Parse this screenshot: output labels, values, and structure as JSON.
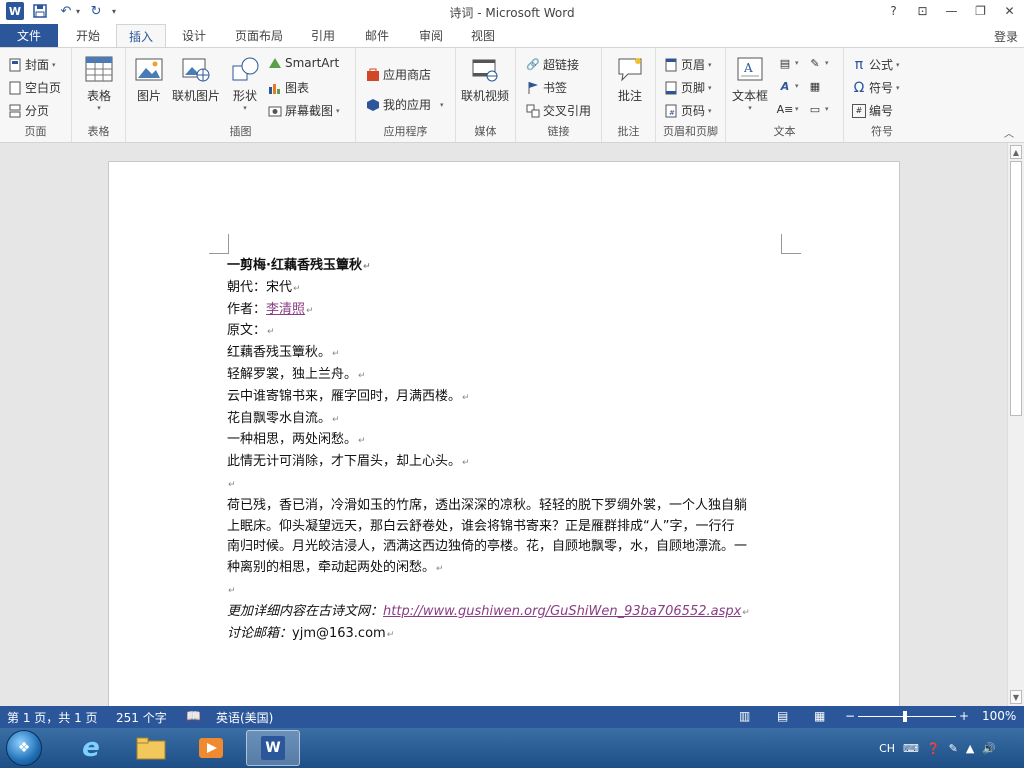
{
  "window": {
    "title": "诗词 - Microsoft Word",
    "controls": {
      "help": "?",
      "ribbon_opts": "⊡",
      "min": "—",
      "restore": "❐",
      "close": "✕"
    }
  },
  "qat": {
    "logo": "W"
  },
  "tabs": [
    {
      "label": "文件"
    },
    {
      "label": "开始"
    },
    {
      "label": "插入"
    },
    {
      "label": "设计"
    },
    {
      "label": "页面布局"
    },
    {
      "label": "引用"
    },
    {
      "label": "邮件"
    },
    {
      "label": "审阅"
    },
    {
      "label": "视图"
    }
  ],
  "login": "登录",
  "ribbon": {
    "groups": {
      "pages": {
        "label": "页面",
        "cover": "封面",
        "blank": "空白页",
        "break": "分页"
      },
      "tables": {
        "label": "表格",
        "table": "表格"
      },
      "illustrations": {
        "label": "插图",
        "picture": "图片",
        "online_picture": "联机图片",
        "shapes": "形状",
        "smartart": "SmartArt",
        "chart": "图表",
        "screenshot": "屏幕截图"
      },
      "apps": {
        "label": "应用程序",
        "store": "应用商店",
        "my_apps": "我的应用"
      },
      "media": {
        "label": "媒体",
        "online_video": "联机视频"
      },
      "links": {
        "label": "链接",
        "hyperlink": "超链接",
        "bookmark": "书签",
        "cross_ref": "交叉引用"
      },
      "comments": {
        "label": "批注",
        "comment": "批注"
      },
      "header_footer": {
        "label": "页眉和页脚",
        "header": "页眉",
        "footer": "页脚",
        "page_number": "页码"
      },
      "text": {
        "label": "文本",
        "textbox": "文本框"
      },
      "symbols": {
        "label": "符号",
        "equation": "公式",
        "symbol": "符号",
        "number": "编号"
      }
    }
  },
  "document": {
    "title": "一剪梅·红藕香残玉簟秋",
    "dynasty_label": "朝代：",
    "dynasty": "宋代",
    "author_label": "作者：",
    "author": "李清照",
    "original_label": "原文：",
    "poem_lines": [
      "红藕香残玉簟秋。",
      "轻解罗裳，独上兰舟。",
      "云中谁寄锦书来，雁字回时，月满西楼。",
      "花自飘零水自流。",
      "一种相思，两处闲愁。",
      "此情无计可消除，才下眉头，却上心头。"
    ],
    "translation": [
      "荷已残，香已消，冷滑如玉的竹席，透出深深的凉秋。轻轻的脱下罗绸外裳，一个人独自躺",
      "上眠床。仰头凝望远天，那白云舒卷处，谁会将锦书寄来？正是雁群排成“人”字，一行行",
      "南归时候。月光皎洁浸人，洒满这西边独倚的亭楼。花，自顾地飘零，水，自顾地漂流。一",
      "种离别的相思，牵动起两处的闲愁。"
    ],
    "more_label": "更加详细内容在古诗文网：",
    "more_url": "http://www.gushiwen.org/GuShiWen_93ba706552.aspx",
    "email_label": "讨论邮箱：",
    "email": "yjm@163.com"
  },
  "statusbar": {
    "page": "第 1 页，共 1 页",
    "words": "251 个字",
    "language": "英语(美国)",
    "zoom": "100%",
    "zoom_minus": "−",
    "zoom_plus": "+"
  },
  "tray": {
    "lang": "CH"
  }
}
